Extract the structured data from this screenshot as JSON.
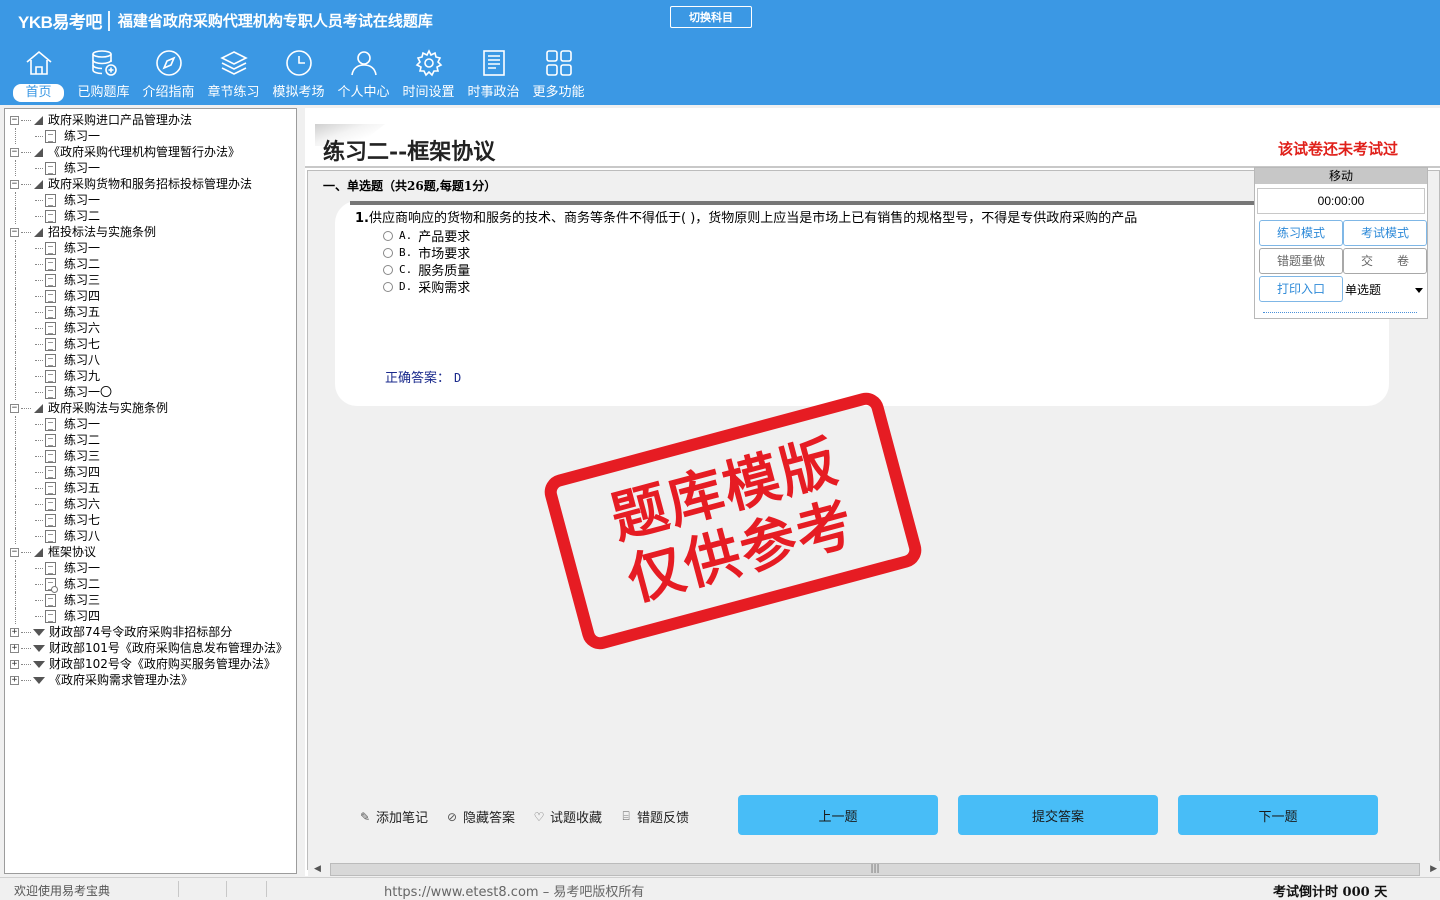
{
  "header": {
    "logo": "YKB易考吧",
    "app_title": "福建省政府采购代理机构专职人员考试在线题库",
    "switch_subject": "切换科目"
  },
  "nav": [
    {
      "label": "首页",
      "icon": "home-icon",
      "active": true
    },
    {
      "label": "已购题库",
      "icon": "database-icon"
    },
    {
      "label": "介绍指南",
      "icon": "compass-icon"
    },
    {
      "label": "章节练习",
      "icon": "layers-icon"
    },
    {
      "label": "模拟考场",
      "icon": "clock-icon"
    },
    {
      "label": "个人中心",
      "icon": "user-icon"
    },
    {
      "label": "时间设置",
      "icon": "gear-icon"
    },
    {
      "label": "时事政治",
      "icon": "news-icon"
    },
    {
      "label": "更多功能",
      "icon": "grid-icon"
    }
  ],
  "tree": [
    {
      "label": "政府采购进口产品管理办法",
      "expanded": true,
      "children": [
        "练习一"
      ]
    },
    {
      "label": "《政府采购代理机构管理暂行办法》",
      "expanded": true,
      "children": [
        "练习一"
      ]
    },
    {
      "label": "政府采购货物和服务招标投标管理办法",
      "expanded": true,
      "children": [
        "练习一",
        "练习二"
      ]
    },
    {
      "label": "招投标法与实施条例",
      "expanded": true,
      "children": [
        "练习一",
        "练习二",
        "练习三",
        "练习四",
        "练习五",
        "练习六",
        "练习七",
        "练习八",
        "练习九",
        "练习一〇"
      ]
    },
    {
      "label": "政府采购法与实施条例",
      "expanded": true,
      "children": [
        "练习一",
        "练习二",
        "练习三",
        "练习四",
        "练习五",
        "练习六",
        "练习七",
        "练习八"
      ]
    },
    {
      "label": "框架协议",
      "expanded": true,
      "children": [
        "练习一",
        "练习二",
        "练习三",
        "练习四"
      ],
      "selected_child": 1
    },
    {
      "label": "财政部74号令政府采购非招标部分",
      "expanded": false,
      "children": []
    },
    {
      "label": "财政部101号《政府采购信息发布管理办法》",
      "expanded": false,
      "children": []
    },
    {
      "label": "财政部102号令《政府购买服务管理办法》",
      "expanded": false,
      "children": []
    },
    {
      "label": "《政府采购需求管理办法》",
      "expanded": false,
      "children": []
    }
  ],
  "main": {
    "title": "练习二--框架协议",
    "status": "该试卷还未考试过",
    "section": "一、单选题（共26题,每题1分）",
    "question": {
      "number": "1.",
      "text": "供应商响应的货物和服务的技术、商务等条件不得低于( )，货物原则上应当是市场上已有销售的规格型号，不得是专供政府采购的产品",
      "options": [
        {
          "key": "A.",
          "text": "产品要求"
        },
        {
          "key": "B.",
          "text": "市场要求"
        },
        {
          "key": "C.",
          "text": "服务质量"
        },
        {
          "key": "D.",
          "text": "采购需求"
        }
      ],
      "answer_label": "正确答案：",
      "answer_value": "D"
    },
    "stamp": {
      "line1": "题库模版",
      "line2": "仅供参考"
    },
    "tools": [
      {
        "label": "添加笔记",
        "icon": "pencil-icon"
      },
      {
        "label": "隐藏答案",
        "icon": "eye-icon"
      },
      {
        "label": "试题收藏",
        "icon": "heart-icon"
      },
      {
        "label": "错题反馈",
        "icon": "feedback-icon"
      }
    ],
    "buttons": {
      "prev": "上一题",
      "submit": "提交答案",
      "next": "下一题"
    }
  },
  "panel": {
    "move": "移动",
    "timer": "00:00:00",
    "practice_mode": "练习模式",
    "exam_mode": "考试模式",
    "redo_wrong": "错题重做",
    "hand_in": "交　　卷",
    "print": "打印入口",
    "type_select": "单选题"
  },
  "status": {
    "welcome": "欢迎使用易考宝典",
    "copyright": "https://www.etest8.com – 易考吧版权所有",
    "countdown": "考试倒计时 000 天"
  },
  "colors": {
    "header": "#3b98e4",
    "button": "#48bdf7",
    "stamp": "#e61c23",
    "status_red": "#e0201a"
  }
}
